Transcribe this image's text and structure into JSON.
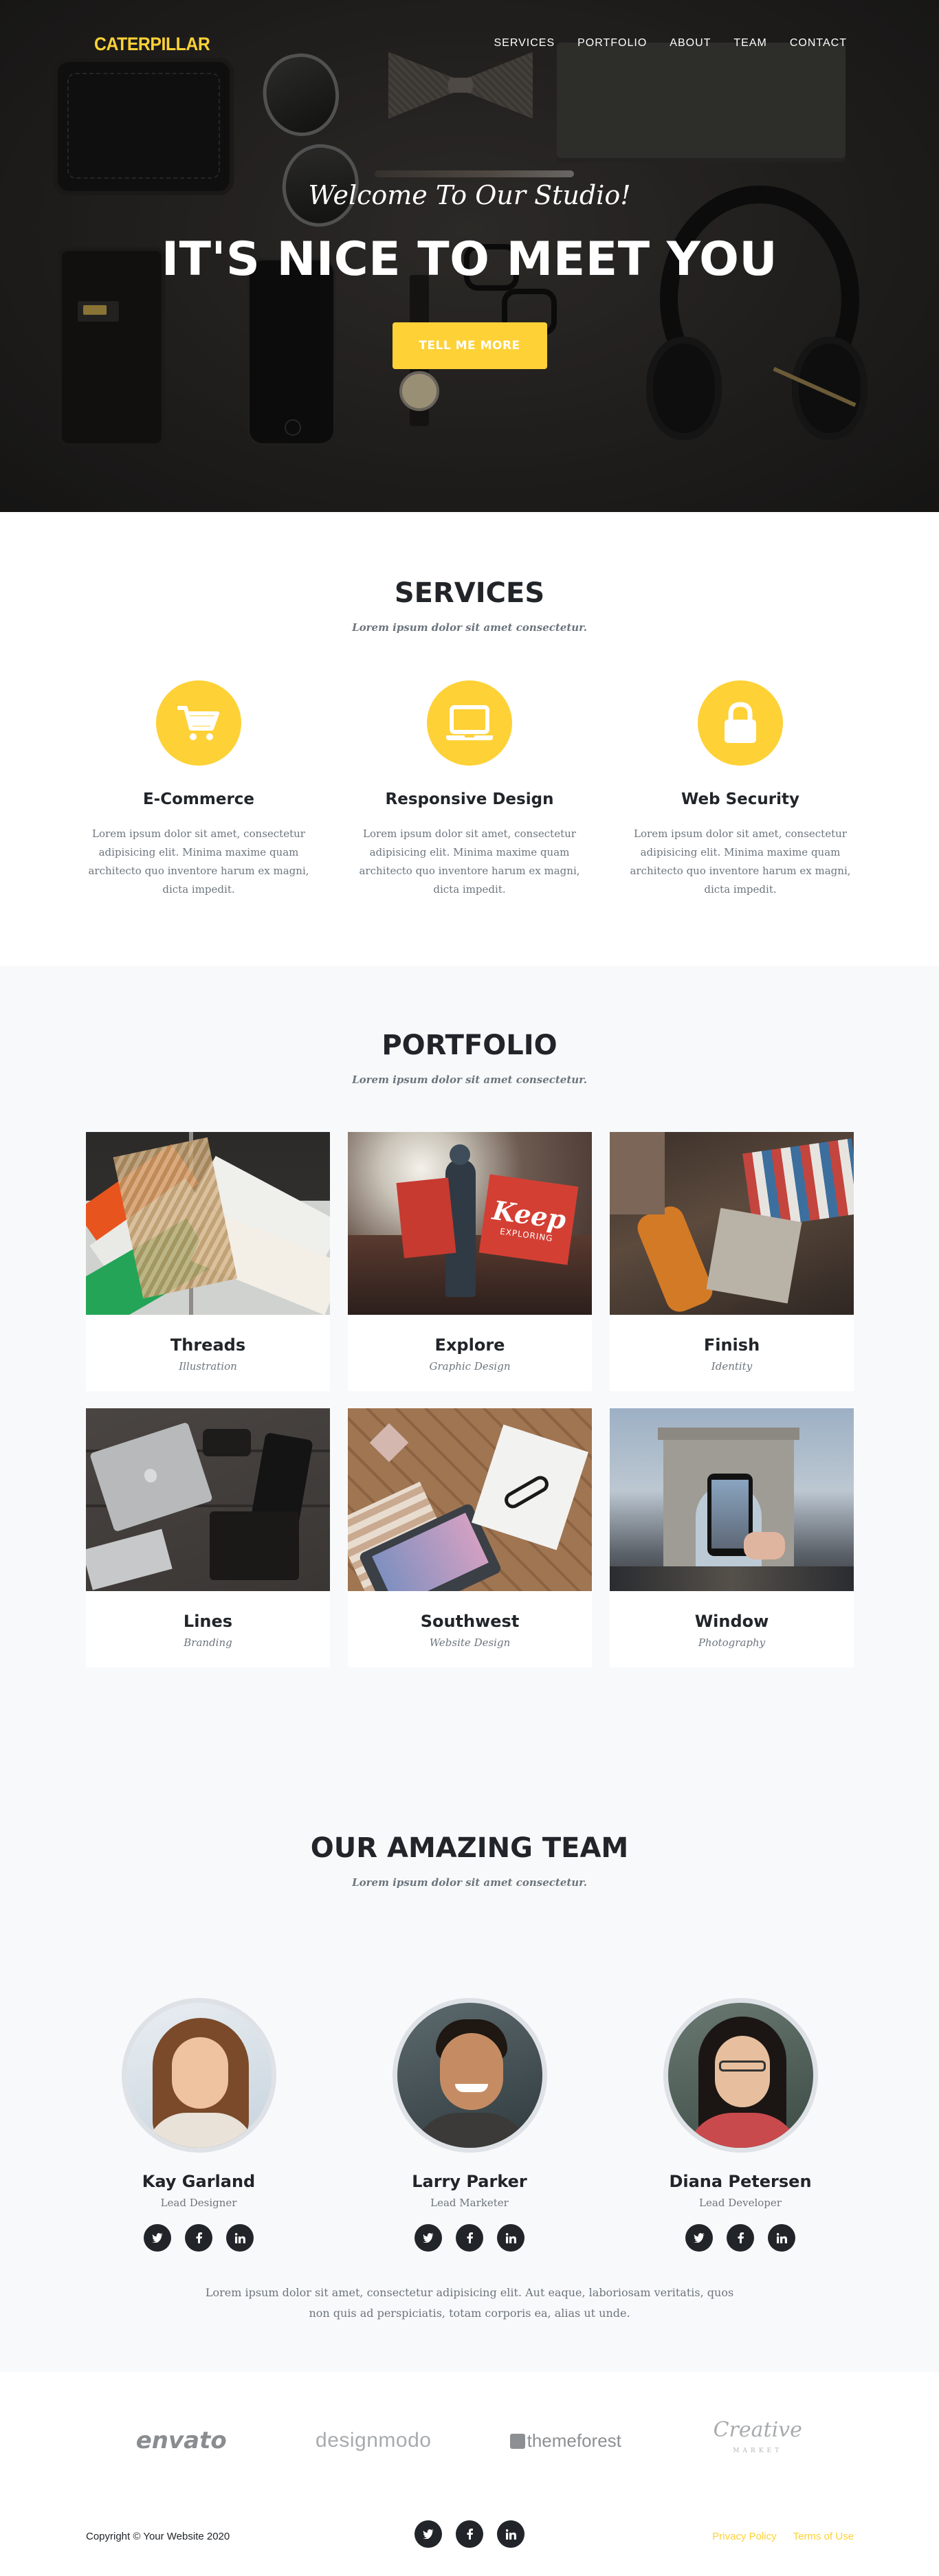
{
  "nav": {
    "brand": "CATERPILLAR",
    "items": [
      {
        "label": "SERVICES"
      },
      {
        "label": "PORTFOLIO"
      },
      {
        "label": "ABOUT"
      },
      {
        "label": "TEAM"
      },
      {
        "label": "CONTACT"
      }
    ]
  },
  "hero": {
    "lead": "Welcome To Our Studio!",
    "heading": "IT'S NICE TO MEET YOU",
    "button": "TELL ME MORE"
  },
  "services": {
    "heading": "SERVICES",
    "subheading": "Lorem ipsum dolor sit amet consectetur.",
    "items": [
      {
        "icon": "shopping-cart-icon",
        "title": "E-Commerce",
        "text": "Lorem ipsum dolor sit amet, consectetur adipisicing elit. Minima maxime quam architecto quo inventore harum ex magni, dicta impedit."
      },
      {
        "icon": "laptop-icon",
        "title": "Responsive Design",
        "text": "Lorem ipsum dolor sit amet, consectetur adipisicing elit. Minima maxime quam architecto quo inventore harum ex magni, dicta impedit."
      },
      {
        "icon": "lock-icon",
        "title": "Web Security",
        "text": "Lorem ipsum dolor sit amet, consectetur adipisicing elit. Minima maxime quam architecto quo inventore harum ex magni, dicta impedit."
      }
    ]
  },
  "portfolio": {
    "heading": "PORTFOLIO",
    "subheading": "Lorem ipsum dolor sit amet consectetur.",
    "items": [
      {
        "title": "Threads",
        "category": "Illustration"
      },
      {
        "title": "Explore",
        "category": "Graphic Design"
      },
      {
        "title": "Finish",
        "category": "Identity"
      },
      {
        "title": "Lines",
        "category": "Branding"
      },
      {
        "title": "Southwest",
        "category": "Website Design"
      },
      {
        "title": "Window",
        "category": "Photography"
      }
    ],
    "explore_flag_text": "Keep",
    "explore_flag_sub": "EXPLORING"
  },
  "team": {
    "heading": "OUR AMAZING TEAM",
    "subheading": "Lorem ipsum dolor sit amet consectetur.",
    "members": [
      {
        "name": "Kay Garland",
        "role": "Lead Designer"
      },
      {
        "name": "Larry Parker",
        "role": "Lead Marketer"
      },
      {
        "name": "Diana Petersen",
        "role": "Lead Developer"
      }
    ],
    "social_icons": [
      "twitter-icon",
      "facebook-icon",
      "linkedin-icon"
    ],
    "text": "Lorem ipsum dolor sit amet, consectetur adipisicing elit. Aut eaque, laboriosam veritatis, quos non quis ad perspiciatis, totam corporis ea, alias ut unde."
  },
  "clients": {
    "logos": [
      {
        "name": "envato"
      },
      {
        "name": "designmodo"
      },
      {
        "name": "themeforest"
      },
      {
        "name": "Creative",
        "sub": "MARKET"
      }
    ]
  },
  "footer": {
    "copyright": "Copyright © Your Website 2020",
    "links": [
      {
        "label": "Privacy Policy"
      },
      {
        "label": "Terms of Use"
      }
    ]
  },
  "colors": {
    "accent": "#fed136",
    "dark": "#212529",
    "muted": "#6c757d",
    "light_bg": "#f8f9fa"
  }
}
